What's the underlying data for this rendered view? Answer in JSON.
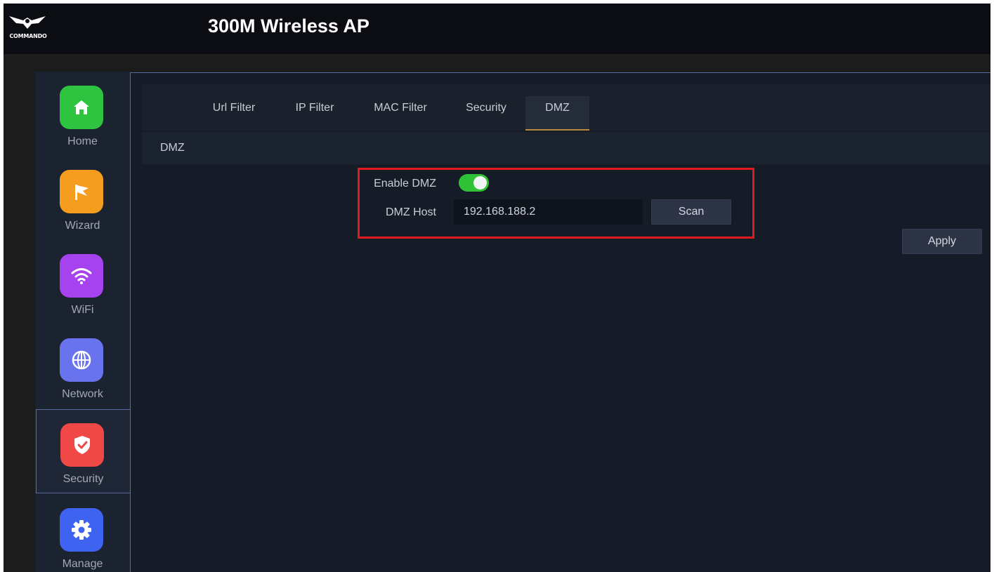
{
  "brand": {
    "logo_text": "COMMANDO",
    "logo_icon": "eagle-emblem-icon"
  },
  "header": {
    "title": "300M Wireless AP"
  },
  "sidebar": {
    "items": [
      {
        "label": "Home",
        "icon": "home-icon",
        "color": "#2ec440",
        "active": false
      },
      {
        "label": "Wizard",
        "icon": "flag-icon",
        "color": "#f59d1f",
        "active": false
      },
      {
        "label": "WiFi",
        "icon": "wifi-icon",
        "color": "#a742ef",
        "active": false
      },
      {
        "label": "Network",
        "icon": "globe-icon",
        "color": "#6a73ee",
        "active": false
      },
      {
        "label": "Security",
        "icon": "shield-check-icon",
        "color": "#f04747",
        "active": true
      },
      {
        "label": "Manage",
        "icon": "gear-icon",
        "color": "#3d63f0",
        "active": false
      }
    ]
  },
  "tabs": [
    {
      "label": "Url Filter",
      "active": false
    },
    {
      "label": "IP Filter",
      "active": false
    },
    {
      "label": "MAC Filter",
      "active": false
    },
    {
      "label": "Security",
      "active": false
    },
    {
      "label": "DMZ",
      "active": true
    }
  ],
  "section": {
    "title": "DMZ"
  },
  "form": {
    "enable_label": "Enable DMZ",
    "enable_state": true,
    "host_label": "DMZ Host",
    "host_value": "192.168.188.2",
    "scan_label": "Scan",
    "apply_label": "Apply"
  },
  "colors": {
    "accent_tab": "#b98a3d",
    "toggle_on": "#2fc236",
    "highlight": "#e11a1a"
  }
}
